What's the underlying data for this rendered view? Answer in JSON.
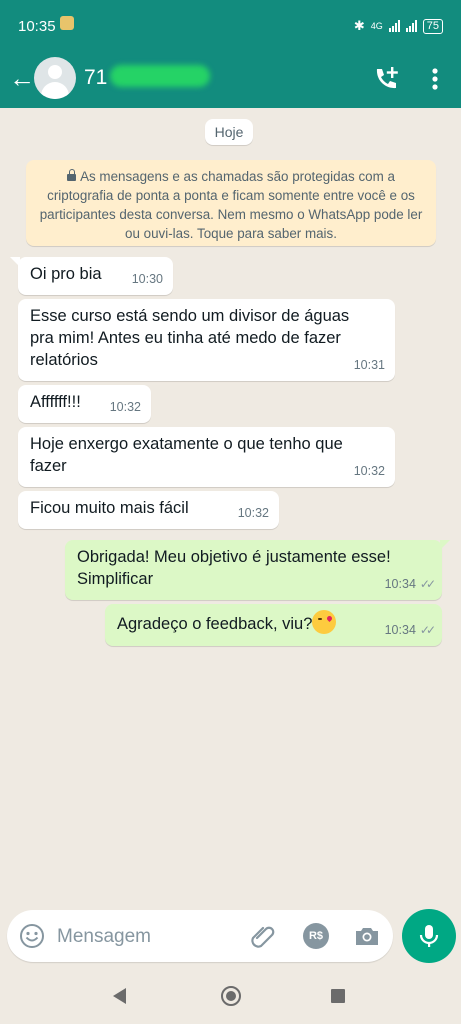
{
  "status_bar": {
    "time": "10:35",
    "network": "4G",
    "battery": "75"
  },
  "header": {
    "contact_name": "71",
    "icons": [
      "back-arrow-icon",
      "avatar-icon",
      "add-call-icon",
      "more-vert-icon"
    ]
  },
  "chat": {
    "date_label": "Hoje",
    "encryption_notice": "As mensagens e as chamadas são protegidas com a criptografia de ponta a ponta e ficam somente entre você e os participantes desta conversa. Nem mesmo o WhatsApp pode ler ou ouvi-las. Toque para saber mais.",
    "messages": [
      {
        "direction": "in",
        "text": "Oi pro bia",
        "time": "10:30"
      },
      {
        "direction": "in",
        "text": "Esse curso está sendo um divisor de águas pra mim! Antes eu tinha até medo de fazer relatórios",
        "time": "10:31"
      },
      {
        "direction": "in",
        "text": "Affffff!!!",
        "time": "10:32"
      },
      {
        "direction": "in",
        "text": "Hoje enxergo exatamente o que tenho que fazer",
        "time": "10:32"
      },
      {
        "direction": "in",
        "text": "Ficou muito mais fácil",
        "time": "10:32"
      },
      {
        "direction": "out",
        "text": "Obrigada! Meu objetivo é justamente esse! Simplificar",
        "time": "10:34",
        "ticks": "✓✓"
      },
      {
        "direction": "out",
        "text": "Agradeço o feedback, viu?",
        "time": "10:34",
        "ticks": "✓✓",
        "emoji": "kissing-heart-emoji"
      }
    ]
  },
  "composer": {
    "placeholder": "Mensagem",
    "rs_label": "R$"
  },
  "colors": {
    "header": "#128c7e",
    "background": "#efeae2",
    "outgoing_bubble": "#dcf8c6",
    "notice_bg": "#ffeecd",
    "mic_button": "#00a884"
  }
}
